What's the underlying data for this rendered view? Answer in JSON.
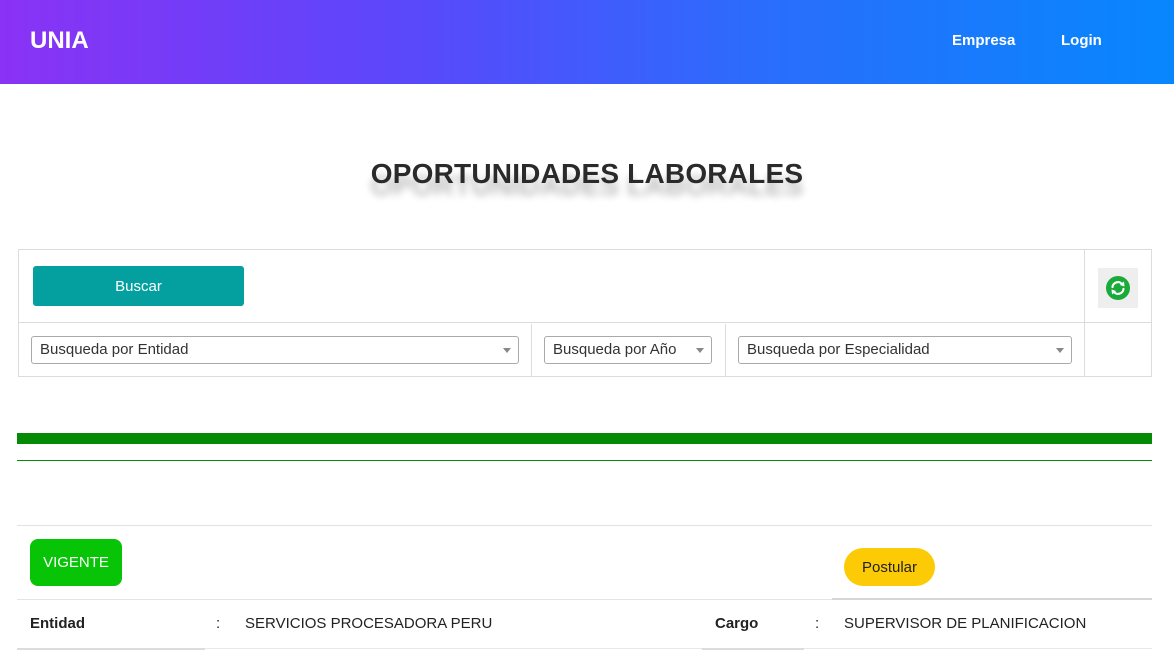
{
  "navbar": {
    "brand": "UNIA",
    "links": [
      {
        "label": "Empresa"
      },
      {
        "label": "Login"
      }
    ]
  },
  "page": {
    "title": "OPORTUNIDADES LABORALES"
  },
  "filters": {
    "search_button": "Buscar",
    "refresh_icon": "refresh-icon",
    "selects": {
      "entidad": "Busqueda por Entidad",
      "anio": "Busqueda por Año",
      "especialidad": "Busqueda por Especialidad"
    }
  },
  "listing": {
    "status_badge": "VIGENTE",
    "apply_button": "Postular",
    "fields": {
      "entidad_label": "Entidad",
      "entidad_value": "SERVICIOS PROCESADORA PERU",
      "cargo_label": "Cargo",
      "cargo_value": "SUPERVISOR DE PLANIFICACION",
      "separator": ":"
    }
  },
  "colors": {
    "nav_gradient_start": "#8a32f5",
    "nav_gradient_end": "#0787fd",
    "search_button": "#049f9f",
    "divider_green": "#058a05",
    "status_green": "#07c407",
    "apply_yellow": "#fccb05",
    "refresh_green": "#1aaa3a"
  }
}
